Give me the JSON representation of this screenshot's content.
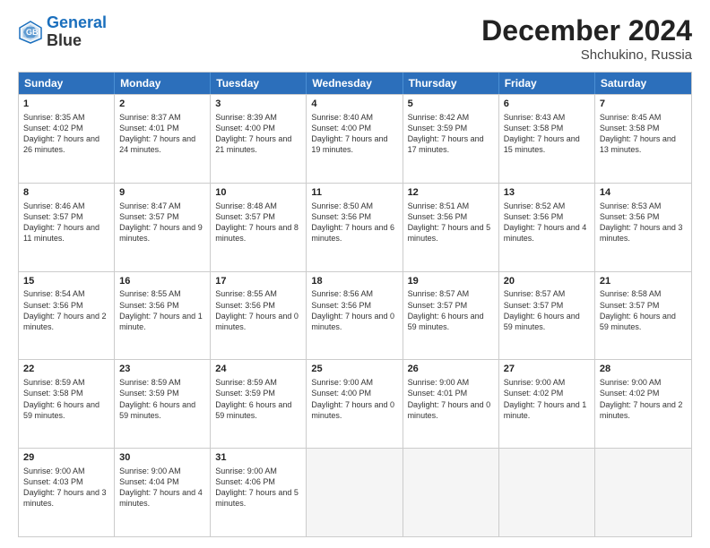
{
  "header": {
    "logo_line1": "General",
    "logo_line2": "Blue",
    "title": "December 2024",
    "subtitle": "Shchukino, Russia"
  },
  "weekdays": [
    "Sunday",
    "Monday",
    "Tuesday",
    "Wednesday",
    "Thursday",
    "Friday",
    "Saturday"
  ],
  "weeks": [
    [
      {
        "day": "1",
        "rise": "8:35 AM",
        "set": "4:02 PM",
        "daylight": "7 hours and 26 minutes."
      },
      {
        "day": "2",
        "rise": "8:37 AM",
        "set": "4:01 PM",
        "daylight": "7 hours and 24 minutes."
      },
      {
        "day": "3",
        "rise": "8:39 AM",
        "set": "4:00 PM",
        "daylight": "7 hours and 21 minutes."
      },
      {
        "day": "4",
        "rise": "8:40 AM",
        "set": "4:00 PM",
        "daylight": "7 hours and 19 minutes."
      },
      {
        "day": "5",
        "rise": "8:42 AM",
        "set": "3:59 PM",
        "daylight": "7 hours and 17 minutes."
      },
      {
        "day": "6",
        "rise": "8:43 AM",
        "set": "3:58 PM",
        "daylight": "7 hours and 15 minutes."
      },
      {
        "day": "7",
        "rise": "8:45 AM",
        "set": "3:58 PM",
        "daylight": "7 hours and 13 minutes."
      }
    ],
    [
      {
        "day": "8",
        "rise": "8:46 AM",
        "set": "3:57 PM",
        "daylight": "7 hours and 11 minutes."
      },
      {
        "day": "9",
        "rise": "8:47 AM",
        "set": "3:57 PM",
        "daylight": "7 hours and 9 minutes."
      },
      {
        "day": "10",
        "rise": "8:48 AM",
        "set": "3:57 PM",
        "daylight": "7 hours and 8 minutes."
      },
      {
        "day": "11",
        "rise": "8:50 AM",
        "set": "3:56 PM",
        "daylight": "7 hours and 6 minutes."
      },
      {
        "day": "12",
        "rise": "8:51 AM",
        "set": "3:56 PM",
        "daylight": "7 hours and 5 minutes."
      },
      {
        "day": "13",
        "rise": "8:52 AM",
        "set": "3:56 PM",
        "daylight": "7 hours and 4 minutes."
      },
      {
        "day": "14",
        "rise": "8:53 AM",
        "set": "3:56 PM",
        "daylight": "7 hours and 3 minutes."
      }
    ],
    [
      {
        "day": "15",
        "rise": "8:54 AM",
        "set": "3:56 PM",
        "daylight": "7 hours and 2 minutes."
      },
      {
        "day": "16",
        "rise": "8:55 AM",
        "set": "3:56 PM",
        "daylight": "7 hours and 1 minute."
      },
      {
        "day": "17",
        "rise": "8:55 AM",
        "set": "3:56 PM",
        "daylight": "7 hours and 0 minutes."
      },
      {
        "day": "18",
        "rise": "8:56 AM",
        "set": "3:56 PM",
        "daylight": "7 hours and 0 minutes."
      },
      {
        "day": "19",
        "rise": "8:57 AM",
        "set": "3:57 PM",
        "daylight": "6 hours and 59 minutes."
      },
      {
        "day": "20",
        "rise": "8:57 AM",
        "set": "3:57 PM",
        "daylight": "6 hours and 59 minutes."
      },
      {
        "day": "21",
        "rise": "8:58 AM",
        "set": "3:57 PM",
        "daylight": "6 hours and 59 minutes."
      }
    ],
    [
      {
        "day": "22",
        "rise": "8:59 AM",
        "set": "3:58 PM",
        "daylight": "6 hours and 59 minutes."
      },
      {
        "day": "23",
        "rise": "8:59 AM",
        "set": "3:59 PM",
        "daylight": "6 hours and 59 minutes."
      },
      {
        "day": "24",
        "rise": "8:59 AM",
        "set": "3:59 PM",
        "daylight": "6 hours and 59 minutes."
      },
      {
        "day": "25",
        "rise": "9:00 AM",
        "set": "4:00 PM",
        "daylight": "7 hours and 0 minutes."
      },
      {
        "day": "26",
        "rise": "9:00 AM",
        "set": "4:01 PM",
        "daylight": "7 hours and 0 minutes."
      },
      {
        "day": "27",
        "rise": "9:00 AM",
        "set": "4:02 PM",
        "daylight": "7 hours and 1 minute."
      },
      {
        "day": "28",
        "rise": "9:00 AM",
        "set": "4:02 PM",
        "daylight": "7 hours and 2 minutes."
      }
    ],
    [
      {
        "day": "29",
        "rise": "9:00 AM",
        "set": "4:03 PM",
        "daylight": "7 hours and 3 minutes."
      },
      {
        "day": "30",
        "rise": "9:00 AM",
        "set": "4:04 PM",
        "daylight": "7 hours and 4 minutes."
      },
      {
        "day": "31",
        "rise": "9:00 AM",
        "set": "4:06 PM",
        "daylight": "7 hours and 5 minutes."
      },
      null,
      null,
      null,
      null
    ]
  ]
}
